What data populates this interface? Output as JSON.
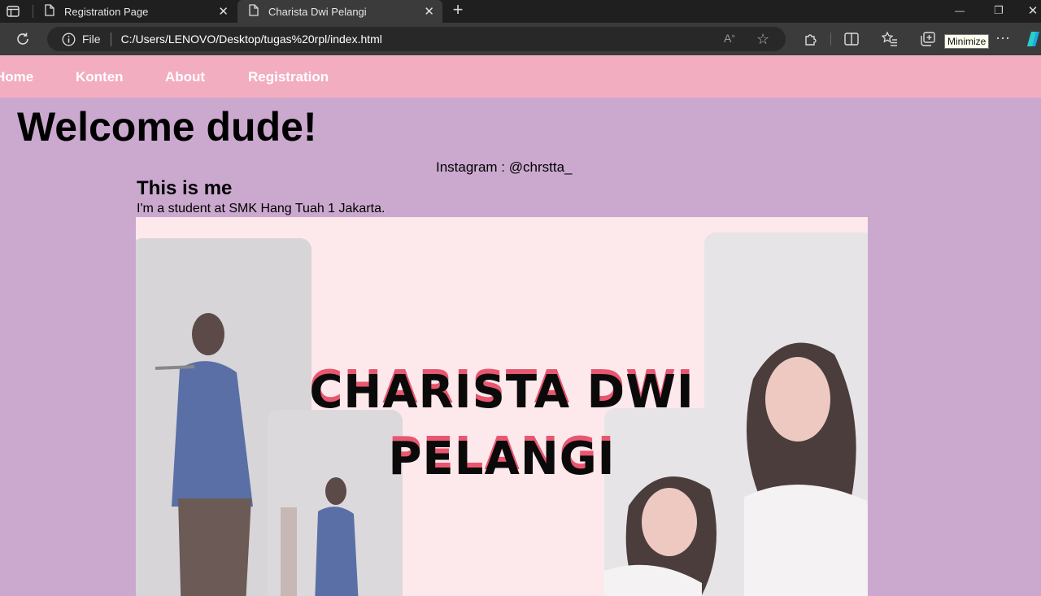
{
  "browser": {
    "tabs": [
      {
        "label": "Registration Page",
        "close": "✕"
      },
      {
        "label": "Charista Dwi Pelangi",
        "close": "✕"
      }
    ],
    "new_tab": "+",
    "window_controls": {
      "minimize": "—",
      "restore": "❐",
      "close": "✕"
    },
    "address": {
      "scheme_label": "File",
      "url": "C:/Users/LENOVO/Desktop/tugas%20rpl/index.html"
    },
    "tooltip": "Minimize",
    "icons": [
      "sidebar-icon",
      "page-icon",
      "reload-icon",
      "info-icon",
      "read-aloud-icon",
      "favorite-star-icon",
      "extensions-icon",
      "split-screen-icon",
      "favorites-icon",
      "collections-icon",
      "more-icon",
      "copilot-icon"
    ]
  },
  "nav": {
    "items": [
      "Home",
      "Konten",
      "About",
      "Registration"
    ]
  },
  "page": {
    "heading": "Welcome dude!",
    "instagram": "Instagram : @chrstta_",
    "subheading": "This is me",
    "bio": "I'm a student at SMK Hang Tuah 1 Jakarta.",
    "hero": {
      "line1": "CHARISTA DWI",
      "line2": "PELANGI"
    }
  },
  "colors": {
    "page_bg": "#cba9cf",
    "navbar_bg": "#f2adc1",
    "hero_bg": "#fde9ec",
    "title_accent": "#e8576f"
  }
}
